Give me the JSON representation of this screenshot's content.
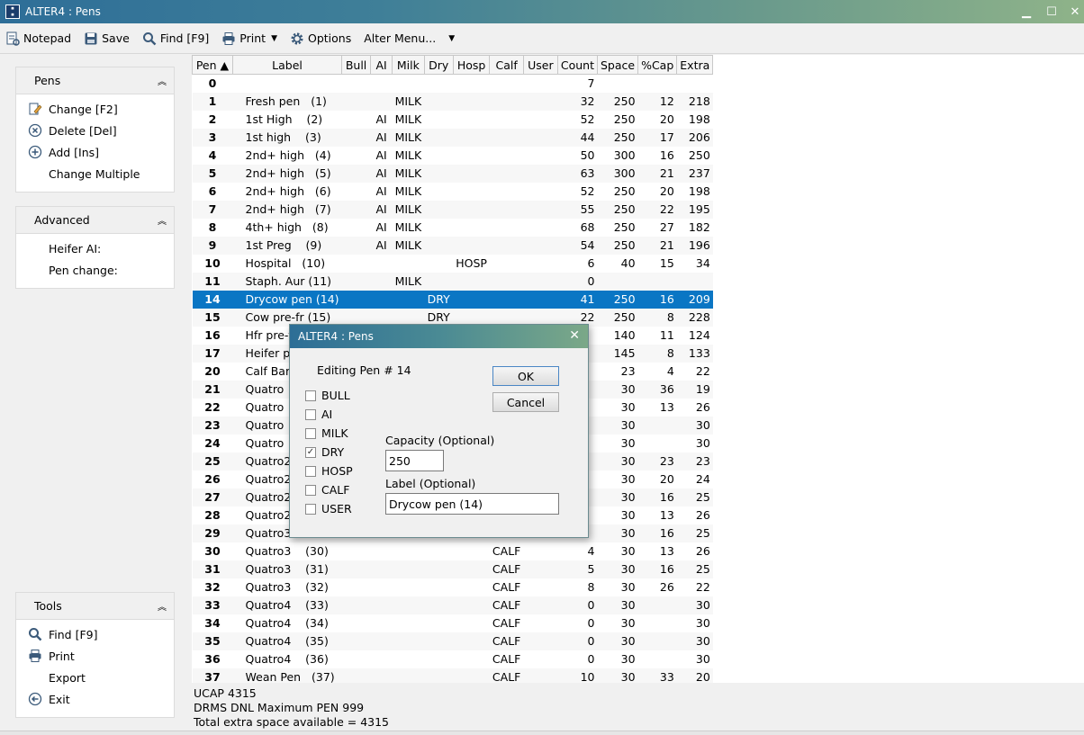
{
  "window": {
    "title": "ALTER4 : Pens",
    "minimize": "▁",
    "maximize": "☐",
    "close": "✕"
  },
  "toolbar": {
    "notepad": "Notepad",
    "save": "Save",
    "find": "Find [F9]",
    "print": "Print",
    "options": "Options",
    "alter_menu": "Alter Menu...",
    "dropdown_glyph": "▼"
  },
  "sidebar": {
    "pens": {
      "title": "Pens",
      "items": [
        "Change [F2]",
        "Delete [Del]",
        "Add [Ins]",
        "Change Multiple"
      ]
    },
    "advanced": {
      "title": "Advanced",
      "items": [
        "Heifer AI:",
        "Pen change:"
      ]
    },
    "tools": {
      "title": "Tools",
      "items": [
        "Find [F9]",
        "Print",
        "Export",
        "Exit"
      ]
    },
    "collapse_glyph": "︽"
  },
  "grid": {
    "columns": [
      "Pen ▲",
      "Label",
      "Bull",
      "AI",
      "Milk",
      "Dry",
      "Hosp",
      "Calf",
      "User",
      "Count",
      "Space",
      "%Cap",
      "Extra"
    ],
    "rows": [
      [
        "0",
        "",
        "",
        "",
        "",
        "",
        "",
        "",
        "",
        "7",
        "",
        "",
        ""
      ],
      [
        "1",
        "Fresh pen   (1)",
        "",
        "",
        "MILK",
        "",
        "",
        "",
        "",
        "32",
        "250",
        "12",
        "218"
      ],
      [
        "2",
        "1st High    (2)",
        "",
        "AI",
        "MILK",
        "",
        "",
        "",
        "",
        "52",
        "250",
        "20",
        "198"
      ],
      [
        "3",
        "1st high    (3)",
        "",
        "AI",
        "MILK",
        "",
        "",
        "",
        "",
        "44",
        "250",
        "17",
        "206"
      ],
      [
        "4",
        "2nd+ high   (4)",
        "",
        "AI",
        "MILK",
        "",
        "",
        "",
        "",
        "50",
        "300",
        "16",
        "250"
      ],
      [
        "5",
        "2nd+ high   (5)",
        "",
        "AI",
        "MILK",
        "",
        "",
        "",
        "",
        "63",
        "300",
        "21",
        "237"
      ],
      [
        "6",
        "2nd+ high   (6)",
        "",
        "AI",
        "MILK",
        "",
        "",
        "",
        "",
        "52",
        "250",
        "20",
        "198"
      ],
      [
        "7",
        "2nd+ high   (7)",
        "",
        "AI",
        "MILK",
        "",
        "",
        "",
        "",
        "55",
        "250",
        "22",
        "195"
      ],
      [
        "8",
        "4th+ high   (8)",
        "",
        "AI",
        "MILK",
        "",
        "",
        "",
        "",
        "68",
        "250",
        "27",
        "182"
      ],
      [
        "9",
        "1st Preg    (9)",
        "",
        "AI",
        "MILK",
        "",
        "",
        "",
        "",
        "54",
        "250",
        "21",
        "196"
      ],
      [
        "10",
        "Hospital   (10)",
        "",
        "",
        "",
        "",
        "HOSP",
        "",
        "",
        "6",
        "40",
        "15",
        "34"
      ],
      [
        "11",
        "Staph. Aur (11)",
        "",
        "",
        "MILK",
        "",
        "",
        "",
        "",
        "0",
        "",
        "",
        ""
      ],
      [
        "14",
        "Drycow pen (14)",
        "",
        "",
        "",
        "DRY",
        "",
        "",
        "",
        "41",
        "250",
        "16",
        "209"
      ],
      [
        "15",
        "Cow pre-fr (15)",
        "",
        "",
        "",
        "DRY",
        "",
        "",
        "",
        "22",
        "250",
        "8",
        "228"
      ],
      [
        "16",
        "Hfr pre-fr",
        "",
        "",
        "",
        "",
        "",
        "",
        "",
        "",
        "140",
        "11",
        "124"
      ],
      [
        "17",
        "Heifer pe",
        "",
        "",
        "",
        "",
        "",
        "",
        "",
        "",
        "145",
        "8",
        "133"
      ],
      [
        "20",
        "Calf Barn",
        "",
        "",
        "",
        "",
        "",
        "",
        "",
        "",
        "23",
        "4",
        "22"
      ],
      [
        "21",
        "Quatro",
        "",
        "",
        "",
        "",
        "",
        "",
        "",
        "",
        "30",
        "36",
        "19"
      ],
      [
        "22",
        "Quatro",
        "",
        "",
        "",
        "",
        "",
        "",
        "",
        "",
        "30",
        "13",
        "26"
      ],
      [
        "23",
        "Quatro",
        "",
        "",
        "",
        "",
        "",
        "",
        "",
        "",
        "30",
        "",
        "30"
      ],
      [
        "24",
        "Quatro",
        "",
        "",
        "",
        "",
        "",
        "",
        "",
        "",
        "30",
        "",
        "30"
      ],
      [
        "25",
        "Quatro2",
        "",
        "",
        "",
        "",
        "",
        "",
        "",
        "",
        "30",
        "23",
        "23"
      ],
      [
        "26",
        "Quatro2",
        "",
        "",
        "",
        "",
        "",
        "",
        "",
        "",
        "30",
        "20",
        "24"
      ],
      [
        "27",
        "Quatro2",
        "",
        "",
        "",
        "",
        "",
        "",
        "",
        "",
        "30",
        "16",
        "25"
      ],
      [
        "28",
        "Quatro2",
        "",
        "",
        "",
        "",
        "",
        "",
        "",
        "",
        "30",
        "13",
        "26"
      ],
      [
        "29",
        "Quatro3",
        "",
        "",
        "",
        "",
        "",
        "",
        "",
        "",
        "30",
        "16",
        "25"
      ],
      [
        "30",
        "Quatro3    (30)",
        "",
        "",
        "",
        "",
        "",
        "CALF",
        "",
        "4",
        "30",
        "13",
        "26"
      ],
      [
        "31",
        "Quatro3    (31)",
        "",
        "",
        "",
        "",
        "",
        "CALF",
        "",
        "5",
        "30",
        "16",
        "25"
      ],
      [
        "32",
        "Quatro3    (32)",
        "",
        "",
        "",
        "",
        "",
        "CALF",
        "",
        "8",
        "30",
        "26",
        "22"
      ],
      [
        "33",
        "Quatro4    (33)",
        "",
        "",
        "",
        "",
        "",
        "CALF",
        "",
        "0",
        "30",
        "",
        "30"
      ],
      [
        "34",
        "Quatro4    (34)",
        "",
        "",
        "",
        "",
        "",
        "CALF",
        "",
        "0",
        "30",
        "",
        "30"
      ],
      [
        "35",
        "Quatro4    (35)",
        "",
        "",
        "",
        "",
        "",
        "CALF",
        "",
        "0",
        "30",
        "",
        "30"
      ],
      [
        "36",
        "Quatro4    (36)",
        "",
        "",
        "",
        "",
        "",
        "CALF",
        "",
        "0",
        "30",
        "",
        "30"
      ],
      [
        "37",
        "Wean Pen   (37)",
        "",
        "",
        "",
        "",
        "",
        "CALF",
        "",
        "10",
        "30",
        "33",
        "20"
      ]
    ],
    "selected_index": 12
  },
  "status": {
    "lines": [
      "UCAP 4315",
      "DRMS DNL Maximum PEN 999",
      "Total extra space available = 4315"
    ]
  },
  "dialog": {
    "title": "ALTER4 : Pens",
    "close": "✕",
    "heading": "Editing Pen # 14",
    "ok": "OK",
    "cancel": "Cancel",
    "checkboxes": [
      {
        "label": "BULL",
        "checked": false
      },
      {
        "label": "AI",
        "checked": false
      },
      {
        "label": "MILK",
        "checked": false
      },
      {
        "label": "DRY",
        "checked": true
      },
      {
        "label": "HOSP",
        "checked": false
      },
      {
        "label": "CALF",
        "checked": false
      },
      {
        "label": "USER",
        "checked": false
      }
    ],
    "capacity_label": "Capacity (Optional)",
    "capacity_value": "250",
    "label_label": "Label (Optional)",
    "label_value": "Drycow pen (14)",
    "check_glyph": "✓"
  }
}
